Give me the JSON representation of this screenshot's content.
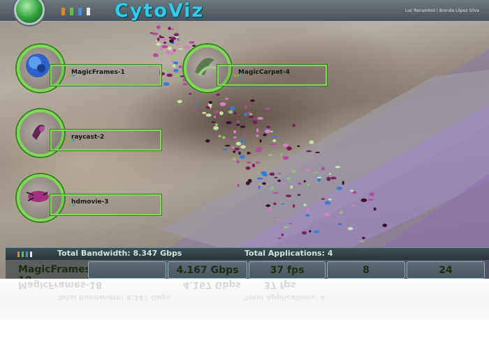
{
  "app": {
    "title": "CytoViz",
    "credits": "Luc Renambot | Brenda López Silva",
    "accent": "#7ed957",
    "title_color": "#35c9ea",
    "swatches": [
      "#d98a2a",
      "#5fc24a",
      "#4b8fd6",
      "#e8e8e8"
    ]
  },
  "applications": [
    {
      "name": "MagicFrames-1",
      "thumbnail_icon": "blue-cell-icon"
    },
    {
      "name": "MagicCarpet-4",
      "thumbnail_icon": "green-ribbon-icon"
    },
    {
      "name": "raycast-2",
      "thumbnail_icon": "purple-shape-icon"
    },
    {
      "name": "hdmovie-3",
      "thumbnail_icon": "magenta-creature-icon"
    }
  ],
  "stats": {
    "bandwidth": "Total Bandwidth: 8.347 Gbps",
    "applications": "Total Applications: 4"
  },
  "row": {
    "name": "MagicFrames-18",
    "bandwidth": "4.167 Gbps",
    "fps": "37 fps",
    "value_a": "8",
    "value_b": "24"
  }
}
